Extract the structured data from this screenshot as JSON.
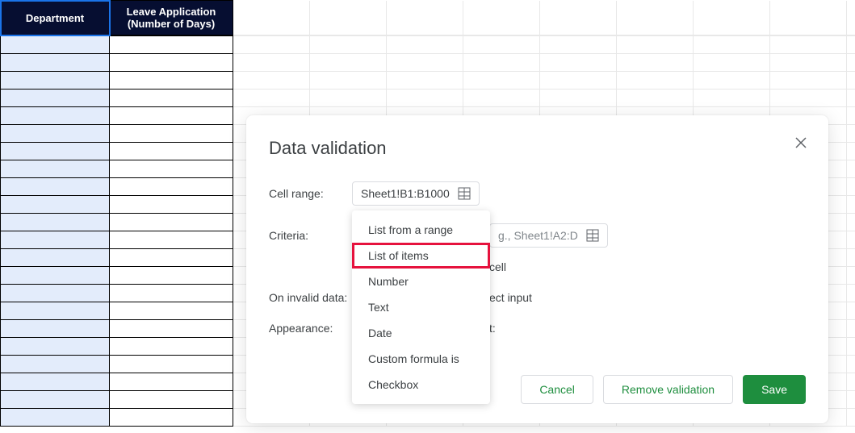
{
  "sheet": {
    "headers": {
      "col_a": "Department",
      "col_b": "Leave Application (Number of Days)"
    }
  },
  "dialog": {
    "title": "Data validation",
    "cell_range": {
      "label": "Cell range:",
      "value": "Sheet1!B1:B1000"
    },
    "criteria": {
      "label": "Criteria:",
      "placeholder": "g., Sheet1!A2:D",
      "options": [
        "List from a range",
        "List of items",
        "Number",
        "Text",
        "Date",
        "Custom formula is",
        "Checkbox"
      ]
    },
    "criteria_cell_text": "cell",
    "invalid_data": {
      "label": "On invalid data:",
      "option_text": "ect input"
    },
    "appearance": {
      "label": "Appearance:",
      "option_text": "t:"
    },
    "buttons": {
      "cancel": "Cancel",
      "remove": "Remove validation",
      "save": "Save"
    }
  }
}
